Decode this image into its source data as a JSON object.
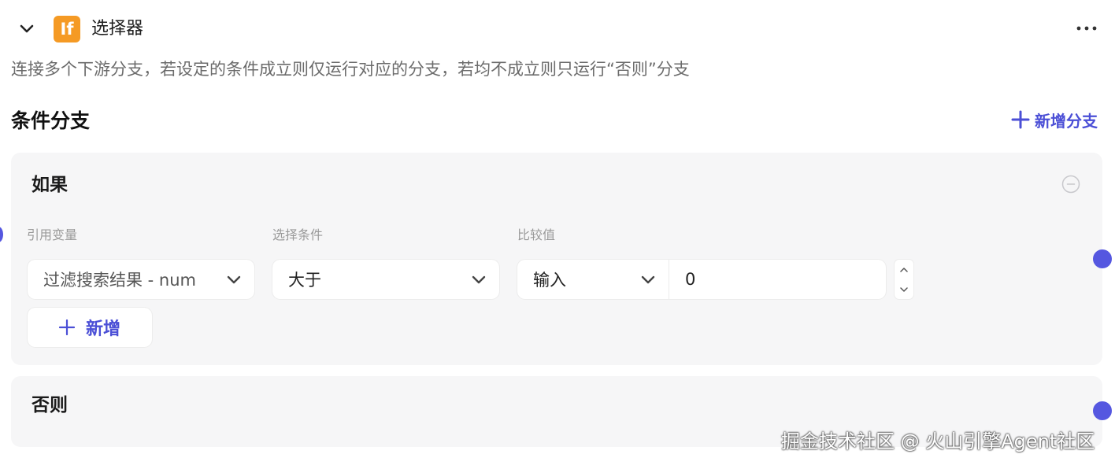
{
  "header": {
    "node_icon_text": "If",
    "title": "选择器"
  },
  "description": "连接多个下游分支，若设定的条件成立则仅运行对应的分支，若均不成立则只运行“否则”分支",
  "section": {
    "title": "条件分支",
    "add_branch_label": "新增分支"
  },
  "if_branch": {
    "heading": "如果",
    "columns": {
      "variable_label": "引用变量",
      "condition_label": "选择条件",
      "compare_label": "比较值"
    },
    "variable_value": "过滤搜索结果 - num",
    "condition_value": "大于",
    "compare_type_value": "输入",
    "compare_input_value": "0",
    "add_condition_label": "新增"
  },
  "else_branch": {
    "heading": "否则"
  },
  "watermark": "掘金技术社区 @ 火山引擎Agent社区",
  "colors": {
    "accent": "#4b4fd6",
    "port": "#5557e0",
    "node_icon_bg": "#f59a24",
    "panel_bg": "#f6f6f7"
  }
}
